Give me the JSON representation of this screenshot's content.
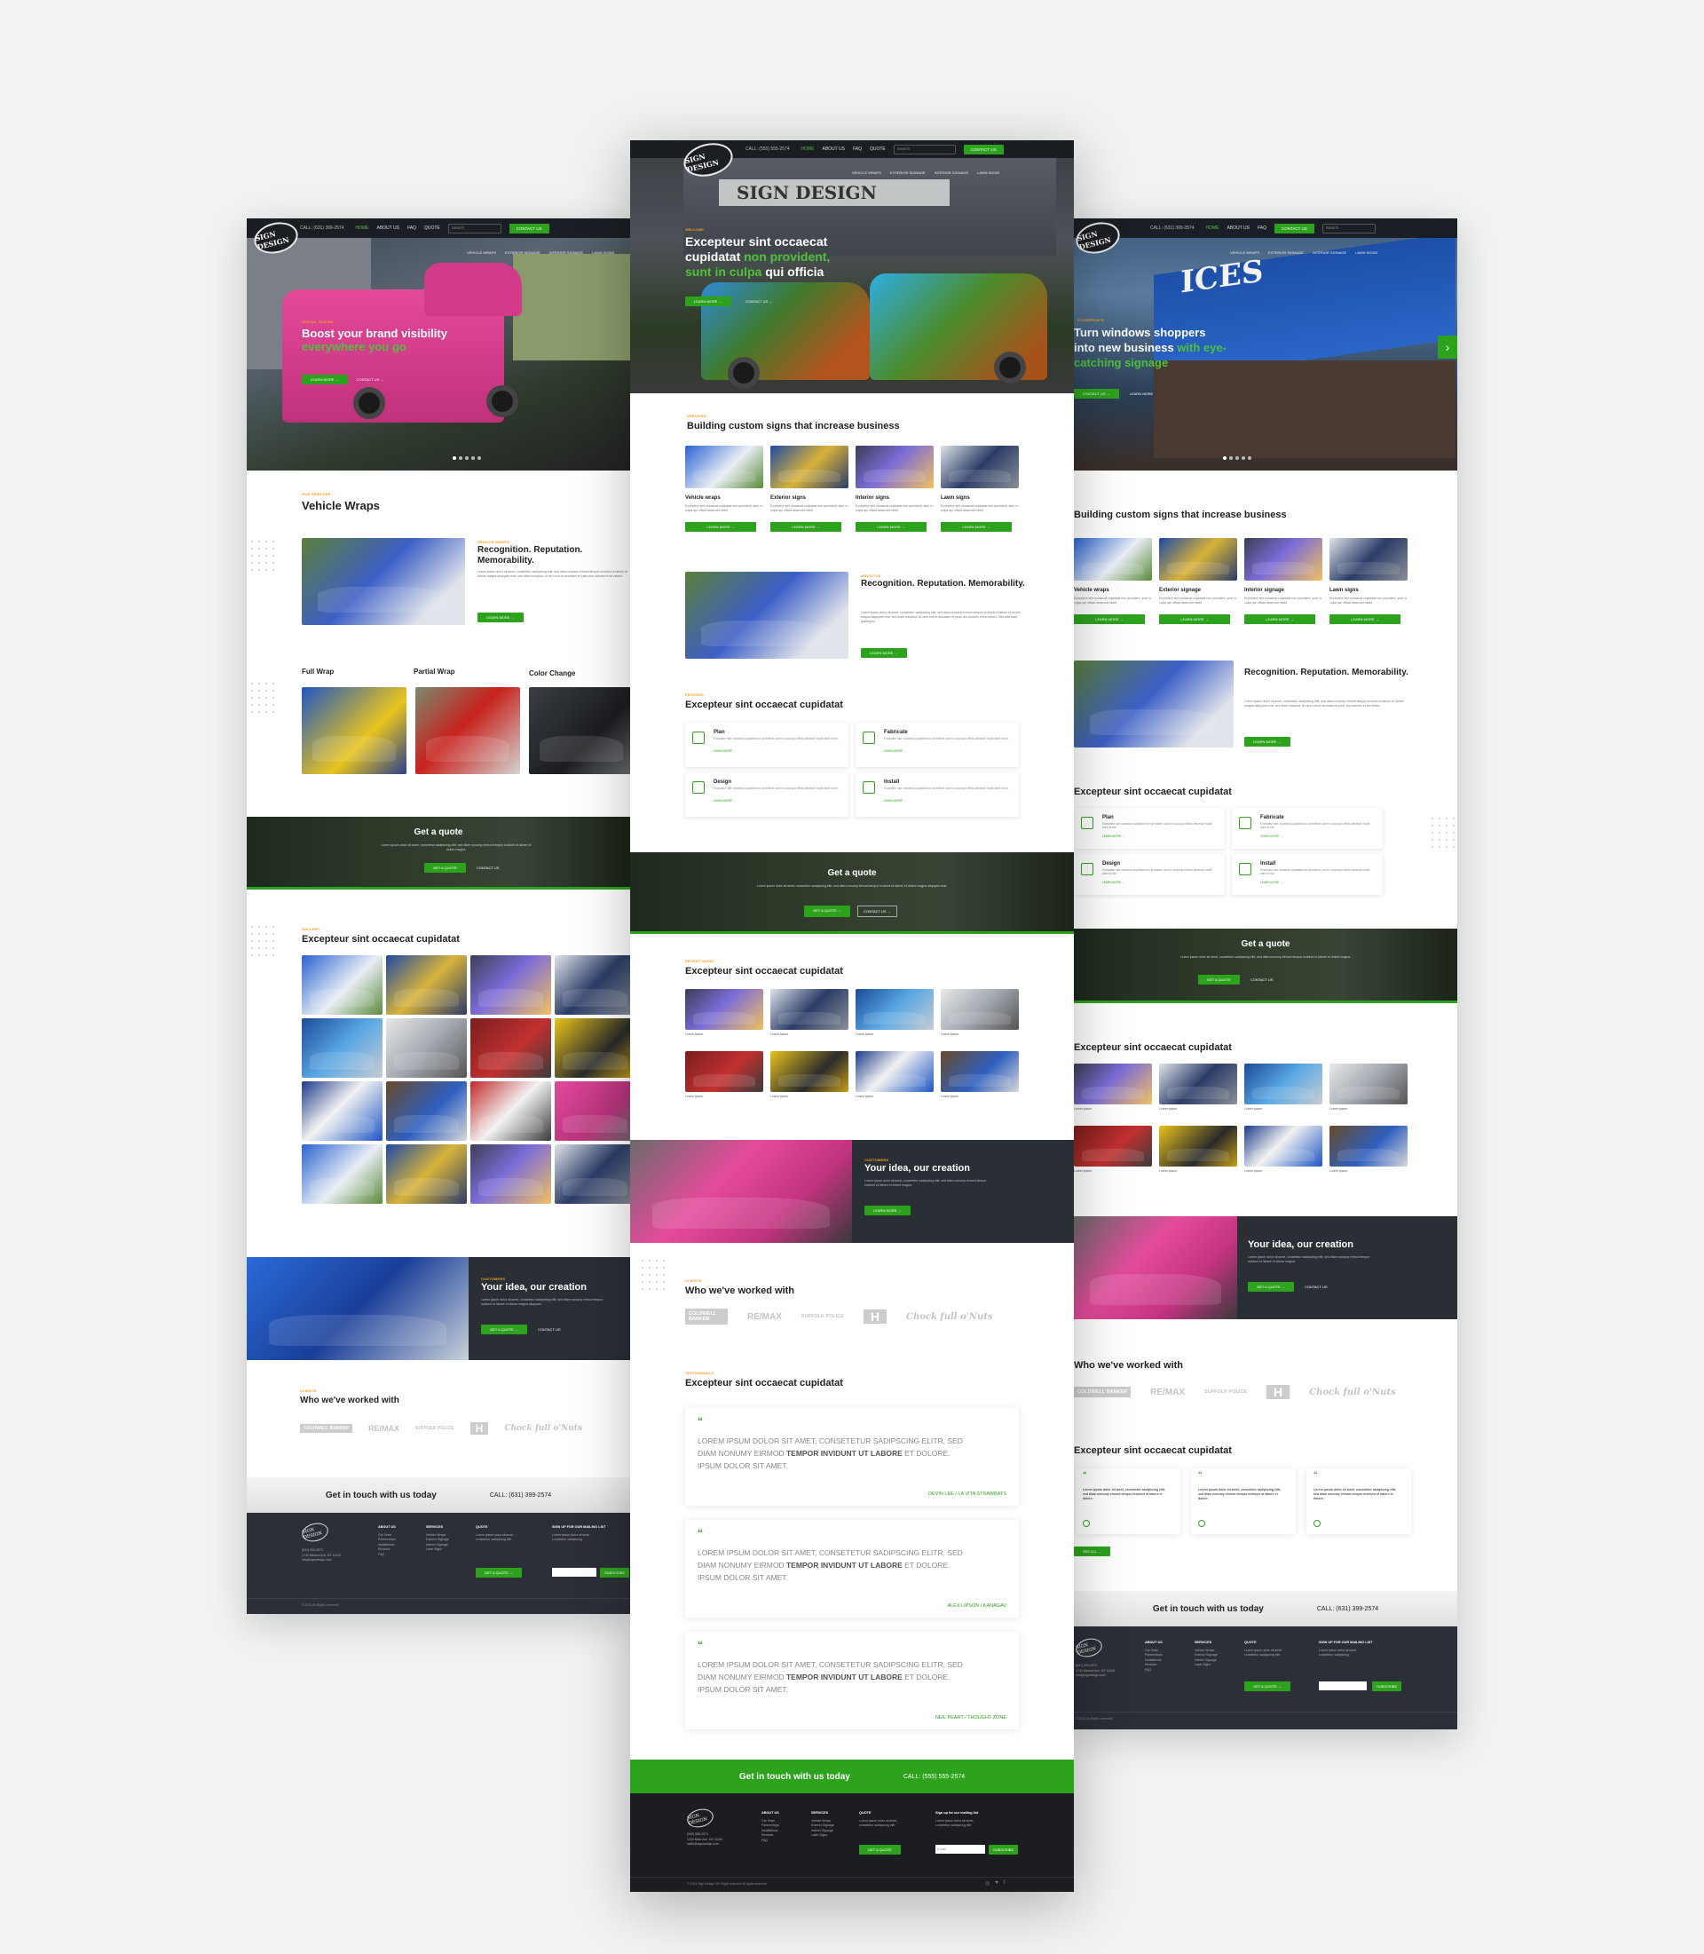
{
  "brand": {
    "logo_text": "SIGN DESIGN",
    "accent": "#2da21c",
    "eyebrow_color": "#f29b1d",
    "dark": "#1b1e22"
  },
  "nav": {
    "phone_left": "CALL: (631) 399-2574",
    "phone_center": "CALL: (555) 555-2574",
    "items": [
      "HOME",
      "ABOUT US",
      "FAQ",
      "QUOTE"
    ],
    "search_placeholder": "Search",
    "cta": "CONTACT US",
    "sub": [
      "VEHICLE WRAPS",
      "EXTERIOR SIGNAGE",
      "INTERIOR SIGNAGE",
      "LAWN SIGNS"
    ]
  },
  "left": {
    "hero": {
      "eyebrow": "SPECIAL TAGLINE",
      "title1": "Boost your brand visibility",
      "title2": "everywhere you go",
      "btn1": "LEARN MORE →",
      "btn2": "CONTACT US →"
    },
    "section_eyebrow": "OUR SERVICES",
    "section_title": "Vehicle Wraps",
    "feature": {
      "eyebrow": "VEHICLE WRAPS",
      "title": "Recognition. Reputation. Memorability.",
      "btn": "LEARN MORE →"
    },
    "wrap_types": [
      "Full Wrap",
      "Partial Wrap",
      "Color Change"
    ],
    "quote": {
      "title": "Get a quote",
      "btn1": "GET A QUOTE",
      "btn2": "CONTACT US"
    },
    "gallery": {
      "eyebrow": "GALLERY",
      "title": "Excepteur sint occaecat cupidatat"
    },
    "idea": {
      "eyebrow": "CUSTOMERS",
      "title": "Your idea, our creation",
      "btn1": "GET A QUOTE →",
      "btn2": "CONTACT US"
    },
    "clients": {
      "eyebrow": "CLIENTS",
      "title": "Who we've worked with"
    },
    "getin": {
      "title": "Get in touch with us today",
      "phone": "CALL: (631) 399-2574"
    },
    "footer": {
      "copy": "© 2021 All Rights reserved",
      "cols": [
        "ABOUT US",
        "SERVICES",
        "QUOTE",
        "SIGN UP FOR OUR MAILING LIST"
      ],
      "btn": "GET A QUOTE →",
      "subscribe": "SUBSCRIBE"
    }
  },
  "center": {
    "hero": {
      "eyebrow": "WELCOME",
      "title1": "Excepteur sint occaecat",
      "title2a": "cupidatat ",
      "title2b": "non provident,",
      "title3a": "sunt in culpa ",
      "title3b": "qui officia",
      "btn1": "LEARN MORE →",
      "btn2": "CONTACT US →"
    },
    "services": {
      "eyebrow": "SERVICES",
      "title": "Building custom signs that increase business",
      "cards": [
        "Vehicle wraps",
        "Exterior signs",
        "Interior signs",
        "Lawn signs"
      ],
      "btn": "LEARN MORE →"
    },
    "feature": {
      "eyebrow": "ABOUT US",
      "title": "Recognition. Reputation. Memorability.",
      "btn": "LEARN MORE →"
    },
    "process": {
      "eyebrow": "PROCESS",
      "title": "Excepteur sint occaecat cupidatat",
      "steps": [
        "Plan",
        "Fabricate",
        "Design",
        "Install"
      ],
      "link": "LEARN MORE →"
    },
    "quote": {
      "title": "Get a quote",
      "btn1": "GET A QUOTE →",
      "btn2": "CONTACT US →"
    },
    "recent": {
      "eyebrow": "RECENT WORK",
      "title": "Excepteur sint occaecat cupidatat",
      "caption": "Lorem ipsum"
    },
    "idea": {
      "eyebrow": "CUSTOMERS",
      "title": "Your idea, our creation",
      "btn": "LEARN MORE →"
    },
    "clients": {
      "eyebrow": "CLIENTS",
      "title": "Who we've worked with",
      "logos": [
        "COLDWELL BANKER",
        "RE/MAX",
        "SUFFOLK POLICE",
        "H",
        "Chock full o'Nuts"
      ]
    },
    "testimonials": {
      "eyebrow": "TESTIMONIALS",
      "title": "Excepteur sint occaecat cupidatat",
      "text_a": "LOREM IPSUM DOLOR SIT AMET, CONSETETUR SADIPSCING ELITR, SED DIAM NONUMY EIRMOD ",
      "text_b": "TEMPOR INVIDUNT UT LABORE",
      "text_c": " ET DOLORE. IPSUM DOLOR SIT AMET.",
      "authors": [
        "DEVIN LEE / LA VITA STRAWBATS",
        "ALEX LIPSON / KANAGAV",
        "NEIL PEART / THOUGHT ZONE"
      ]
    },
    "getin": {
      "title": "Get in touch with us today",
      "phone": "CALL: (555) 555-2574"
    },
    "footer": {
      "copy": "© 2021 Sign Design NY, Right reserved all rights reserved",
      "cols": [
        "ABOUT US",
        "SERVICES",
        "QUOTE",
        "Sign up for our mailing list"
      ],
      "btn": "GET A QUOTE",
      "subscribe": "SUBSCRIBE",
      "email_placeholder": "Email"
    }
  },
  "right": {
    "hero": {
      "eyebrow": "STOREFRONTS",
      "title1": "Turn windows shoppers",
      "title2a": "into new business ",
      "title2b": "with eye-",
      "title3": "catching signage",
      "btn1": "CONTACT US →",
      "btn2": "LEARN MORE"
    },
    "services": {
      "title": "Building custom signs that increase business",
      "cards": [
        "Vehicle wraps",
        "Exterior signage",
        "Interior signage",
        "Lawn signs"
      ]
    },
    "feature": {
      "title": "Recognition. Reputation. Memorability."
    },
    "process": {
      "title": "Excepteur sint occaecat cupidatat",
      "steps": [
        "Plan",
        "Fabricate",
        "Design",
        "Install"
      ]
    },
    "quote": {
      "title": "Get a quote"
    },
    "recent": {
      "title": "Excepteur sint occaecat cupidatat"
    },
    "idea": {
      "title": "Your idea, our creation"
    },
    "clients": {
      "title": "Who we've worked with"
    },
    "testimonials": {
      "title": "Excepteur sint occaecat cupidatat",
      "btn": "SEE ALL →"
    },
    "getin": {
      "title": "Get in touch with us today",
      "phone": "CALL: (631) 399-2574"
    }
  }
}
